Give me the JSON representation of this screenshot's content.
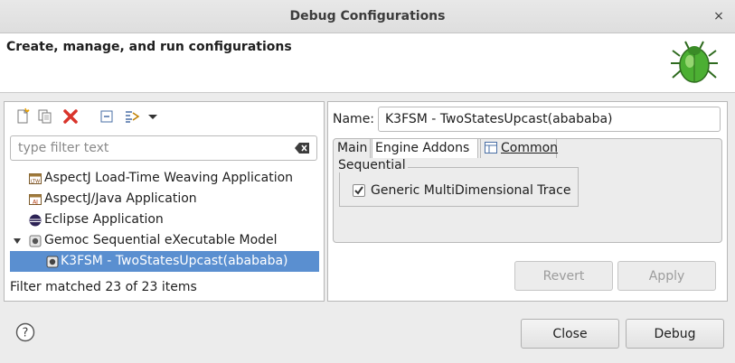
{
  "window": {
    "title": "Debug Configurations",
    "close_glyph": "×"
  },
  "banner": {
    "text": "Create, manage, and run configurations",
    "icon": "bug-icon"
  },
  "left": {
    "toolbar": [
      "new-config-icon",
      "duplicate-icon",
      "delete-icon",
      "collapse-all-icon",
      "filter-icon",
      "dropdown-arrow-icon"
    ],
    "filter_placeholder": "type filter text",
    "tree": [
      {
        "label": "AspectJ Load-Time Weaving Application",
        "icon": "ltw-icon",
        "level": 1
      },
      {
        "label": "AspectJ/Java Application",
        "icon": "aj-icon",
        "level": 1
      },
      {
        "label": "Eclipse Application",
        "icon": "eclipse-icon",
        "level": 1
      },
      {
        "label": "Gemoc Sequential eXecutable Model",
        "icon": "gemoc-icon",
        "level": 0,
        "expanded": true
      },
      {
        "label": "K3FSM - TwoStatesUpcast(abababa)",
        "icon": "gemoc-config-icon",
        "level": 2,
        "selected": true
      }
    ],
    "status": "Filter matched 23 of 23 items"
  },
  "right": {
    "name_label": "Name:",
    "name_value": "K3FSM - TwoStatesUpcast(abababa)",
    "tabs": [
      {
        "label": "Main",
        "active": false
      },
      {
        "label": "Engine Addons",
        "active": true
      },
      {
        "label": "Common",
        "active": false,
        "icon": "common-tab-icon"
      }
    ],
    "group_label": "Sequential",
    "checkbox_label": "Generic MultiDimensional Trace",
    "checkbox_checked": true,
    "revert_label": "Revert",
    "apply_label": "Apply"
  },
  "footer": {
    "help_icon": "help-icon",
    "close_label": "Close",
    "debug_label": "Debug"
  },
  "colors": {
    "selection": "#5a8fd0",
    "delete_red": "#d9342b",
    "bug_green": "#4caf33"
  }
}
